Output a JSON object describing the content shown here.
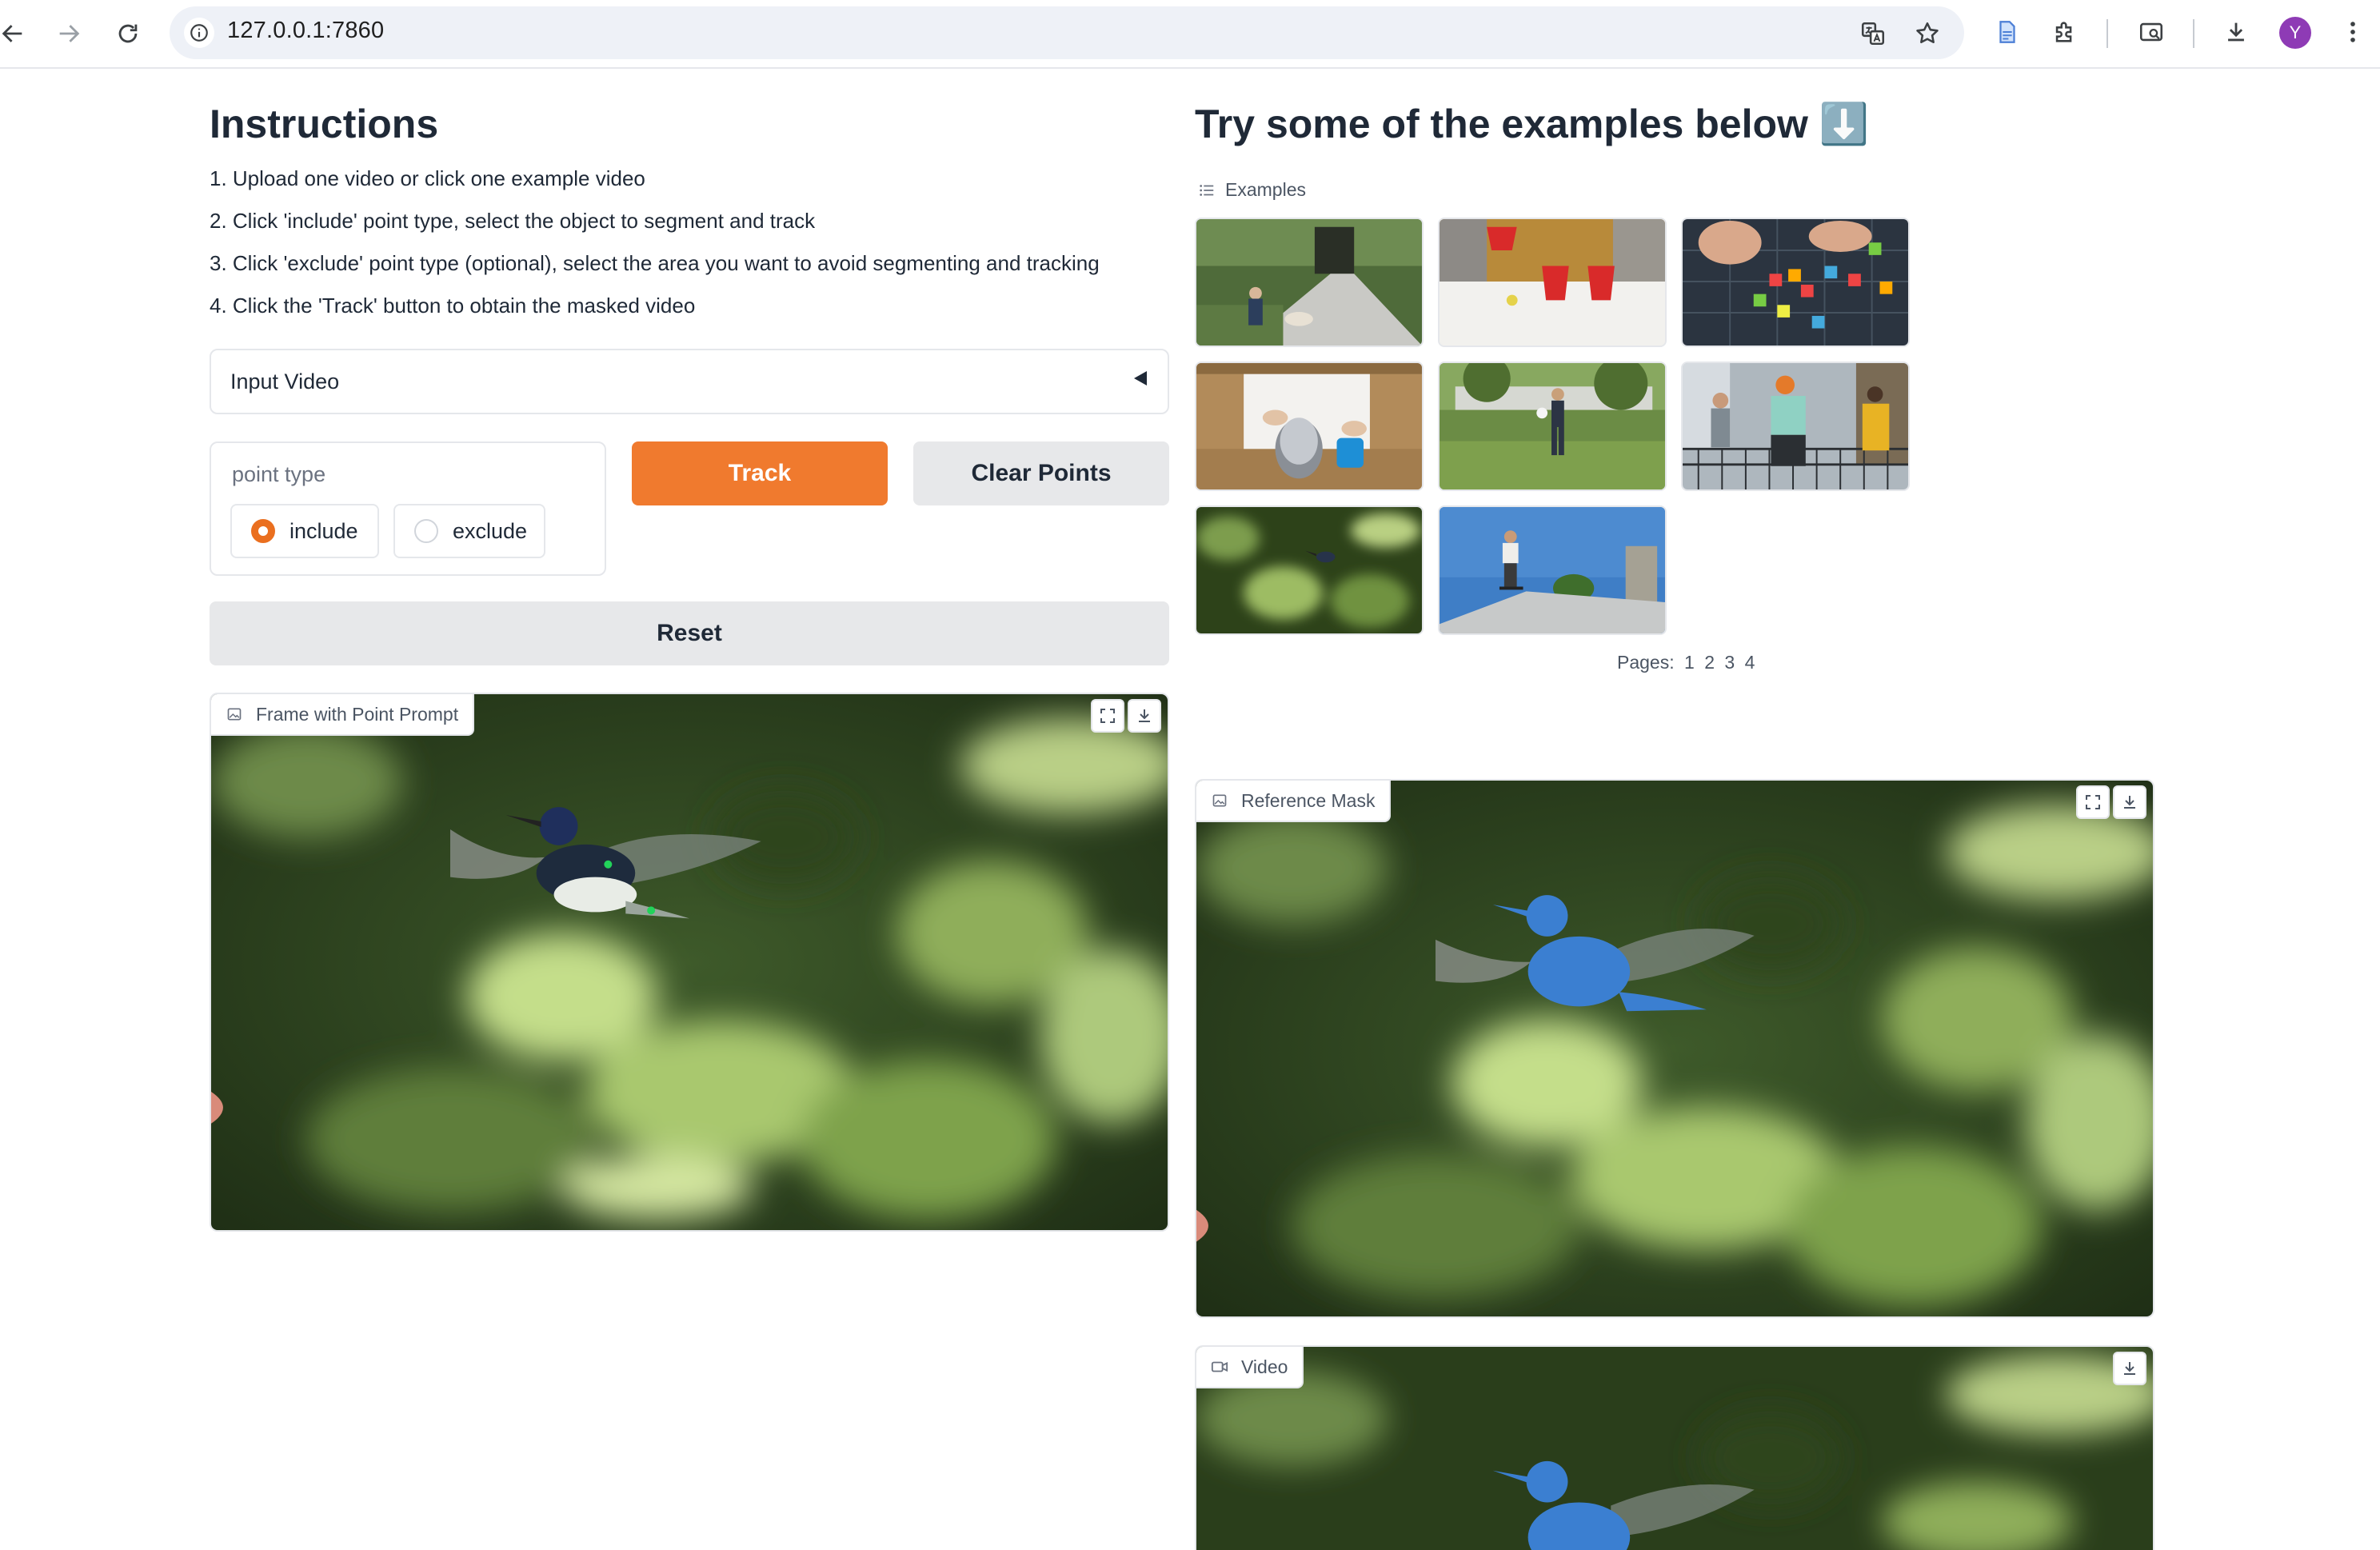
{
  "browser": {
    "url": "127.0.0.1:7860",
    "profile_initial": "Y",
    "icons": [
      "back-arrow-icon",
      "forward-arrow-icon",
      "reload-icon",
      "info-icon",
      "translate-icon",
      "star-icon",
      "document-icon",
      "extensions-icon",
      "tab-search-icon",
      "download-icon",
      "more-icon"
    ]
  },
  "instructions": {
    "title": "Instructions",
    "steps": [
      "1. Upload one video or click one example video",
      "2. Click 'include' point type, select the object to segment and track",
      "3. Click 'exclude' point type (optional), select the area you want to avoid segmenting and tracking",
      "4. Click the 'Track' button to obtain the masked video"
    ]
  },
  "input_video": {
    "label": "Input Video"
  },
  "point_type": {
    "title": "point type",
    "options": [
      "include",
      "exclude"
    ],
    "selected": "include"
  },
  "buttons": {
    "track": "Track",
    "clear": "Clear Points",
    "reset": "Reset"
  },
  "frame_panel": {
    "label": "Frame with Point Prompt"
  },
  "examples": {
    "title": "Try some of the examples below ⬇️",
    "label": "Examples",
    "pages_label": "Pages:",
    "pages": [
      "1",
      "2",
      "3",
      "4"
    ]
  },
  "reference_mask": {
    "label": "Reference Mask"
  },
  "video_panel": {
    "label": "Video"
  },
  "colors": {
    "accent": "#f07a2e",
    "mask_blue": "#3b7fd1"
  }
}
